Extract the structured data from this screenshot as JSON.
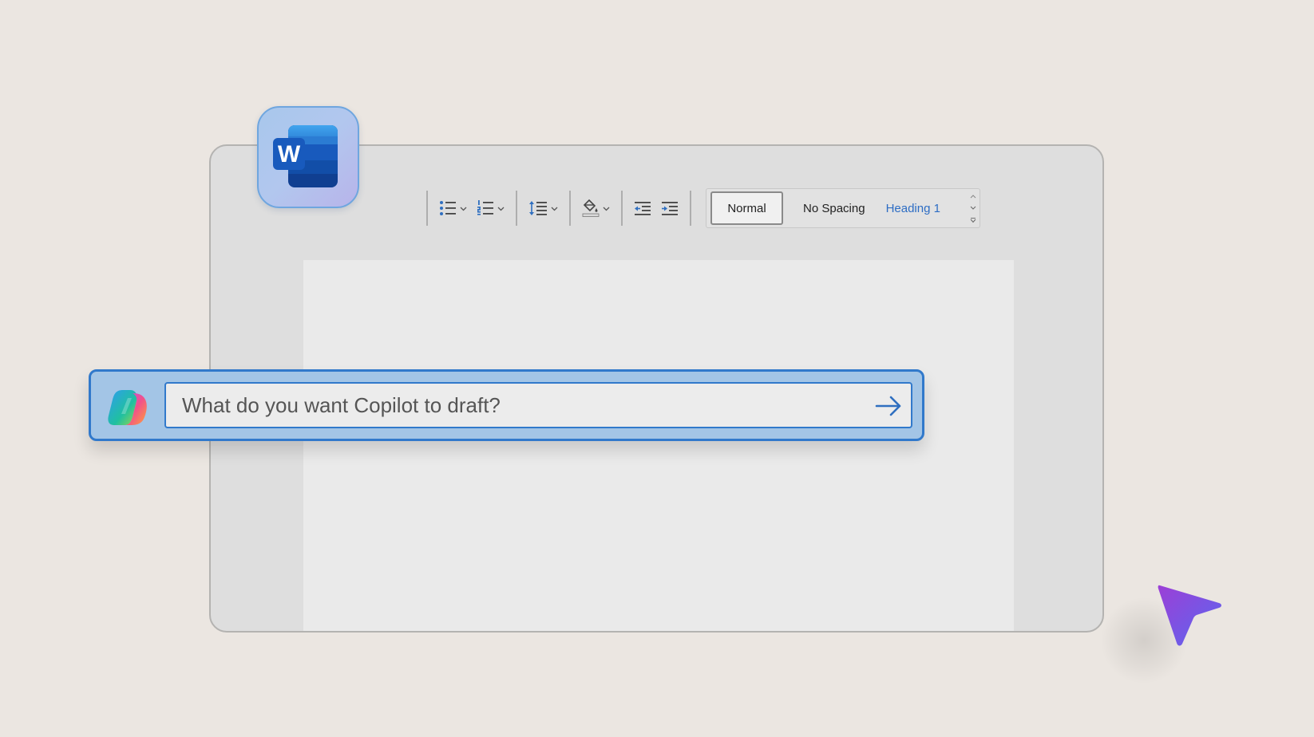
{
  "app": {
    "name": "Word",
    "logo_letter": "W",
    "logo_icon": "word-logo-icon"
  },
  "toolbar": {
    "bullets_icon": "bullet-list-icon",
    "numbering_icon": "numbered-list-icon",
    "line_spacing_icon": "line-spacing-icon",
    "shading_icon": "paint-bucket-icon",
    "decrease_indent_icon": "decrease-indent-icon",
    "increase_indent_icon": "increase-indent-icon",
    "styles": [
      {
        "label": "Normal",
        "selected": true
      },
      {
        "label": "No Spacing",
        "selected": false
      },
      {
        "label": "Heading 1",
        "selected": false
      }
    ]
  },
  "copilot": {
    "icon": "copilot-icon",
    "placeholder": "What do you want Copilot to draft?",
    "value": "",
    "send_icon": "arrow-right-icon"
  },
  "colors": {
    "background": "#ebe6e1",
    "accent": "#3179cb",
    "heading_link": "#2d6dc4",
    "pointer": "#7b4fe0"
  },
  "cursor_icon": "pointer-arrow-icon"
}
